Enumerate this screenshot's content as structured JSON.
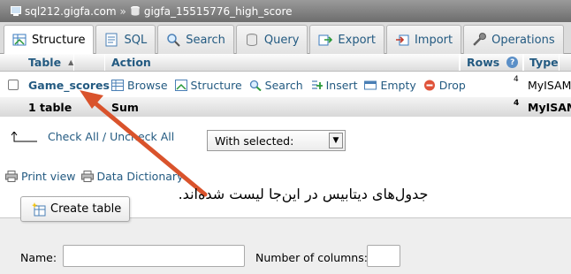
{
  "breadcrumb": {
    "server": "sql212.gigfa.com",
    "separator": "»",
    "database": "gigfa_15515776_high_score"
  },
  "tabs": [
    {
      "label": "Structure",
      "icon": "structure-icon",
      "active": true
    },
    {
      "label": "SQL",
      "icon": "sql-icon"
    },
    {
      "label": "Search",
      "icon": "search-icon"
    },
    {
      "label": "Query",
      "icon": "query-icon"
    },
    {
      "label": "Export",
      "icon": "export-icon"
    },
    {
      "label": "Import",
      "icon": "import-icon"
    },
    {
      "label": "Operations",
      "icon": "wrench-icon"
    }
  ],
  "table": {
    "headers": {
      "table": "Table",
      "action": "Action",
      "rows": "Rows",
      "type": "Type"
    },
    "row": {
      "name": "Game_scores",
      "actions": [
        "Browse",
        "Structure",
        "Search",
        "Insert",
        "Empty",
        "Drop"
      ],
      "rows": "4",
      "type": "MyISAM"
    },
    "summary": {
      "count": "1 table",
      "label": "Sum",
      "rows": "4",
      "type": "MyISAM"
    }
  },
  "check_all": "Check All / Uncheck All",
  "with_selected": "With selected:",
  "print_view": "Print view",
  "data_dictionary": "Data Dictionary",
  "annotation": "جدول‌های دیتابیس در این‌جا لیست شده‌اند.",
  "create_table": {
    "button": "Create table",
    "name_label": "Name:",
    "columns_label": "Number of columns:"
  },
  "colors": {
    "link": "#235a81",
    "arrow": "#d9532c"
  }
}
